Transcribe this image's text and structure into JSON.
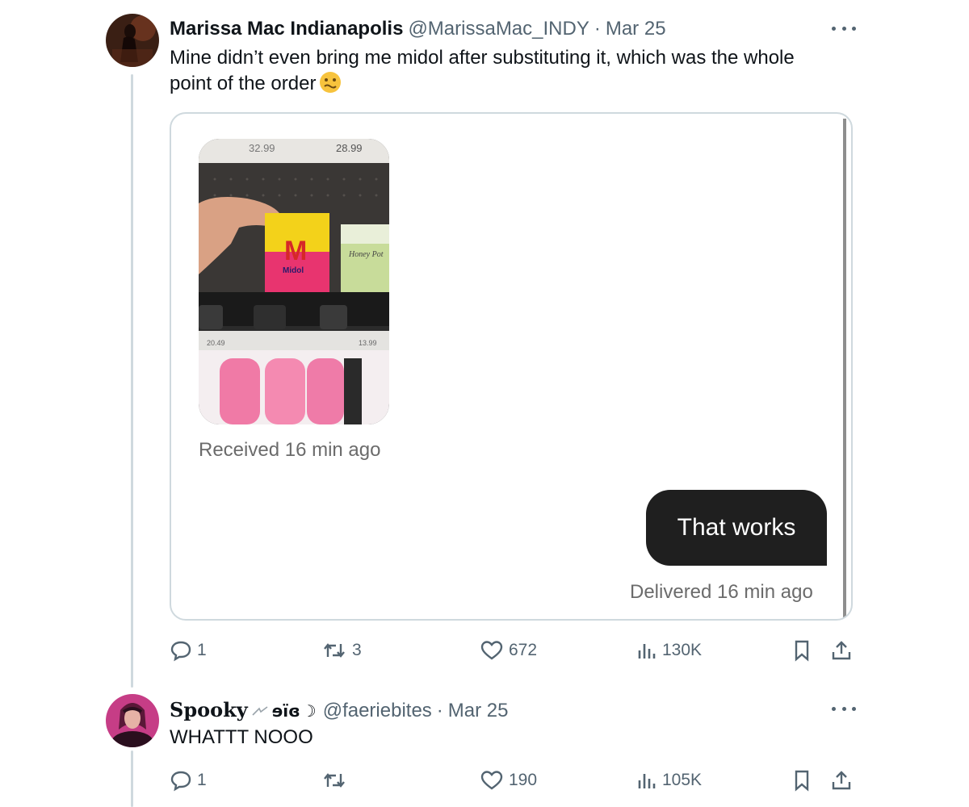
{
  "tweet1": {
    "display_name": "Marissa Mac Indianapolis",
    "handle": "@MarissaMac_INDY",
    "separator": "·",
    "date": "Mar 25",
    "text_line1": "Mine didn’t even bring me midol after substituting it, which was the whole",
    "text_line2": "point of the order",
    "media": {
      "shelf_price_left": "32.99",
      "shelf_price_right": "28.99",
      "box_letter": "M",
      "box_brand": "Midol",
      "green_box_label": "Honey Pot",
      "lower_price_left": "20.49",
      "lower_price_right": "13.99",
      "received_text": "Received 16 min ago",
      "bubble_text": "That works",
      "delivered_text": "Delivered 16 min ago"
    },
    "actions": {
      "replies": "1",
      "retweets": "3",
      "likes": "672",
      "views": "130K"
    }
  },
  "tweet2": {
    "display_name": "Spooky",
    "name_suffix": "ɘïɞ",
    "name_moon": "☽",
    "handle": "@faeriebites",
    "separator": "·",
    "date": "Mar 25",
    "text": "WHATTT NOOO",
    "actions": {
      "replies": "1",
      "retweets": "",
      "likes": "190",
      "views": "105K"
    }
  },
  "colors": {
    "text_primary": "#0f1419",
    "text_secondary": "#536471",
    "thread_line": "#cfd9de",
    "bubble_bg": "#1f1f1f"
  },
  "icons": [
    "more-icon",
    "reply-icon",
    "retweet-icon",
    "like-icon",
    "views-icon",
    "bookmark-icon",
    "share-icon",
    "emoji-icon",
    "butterfly-icon"
  ]
}
